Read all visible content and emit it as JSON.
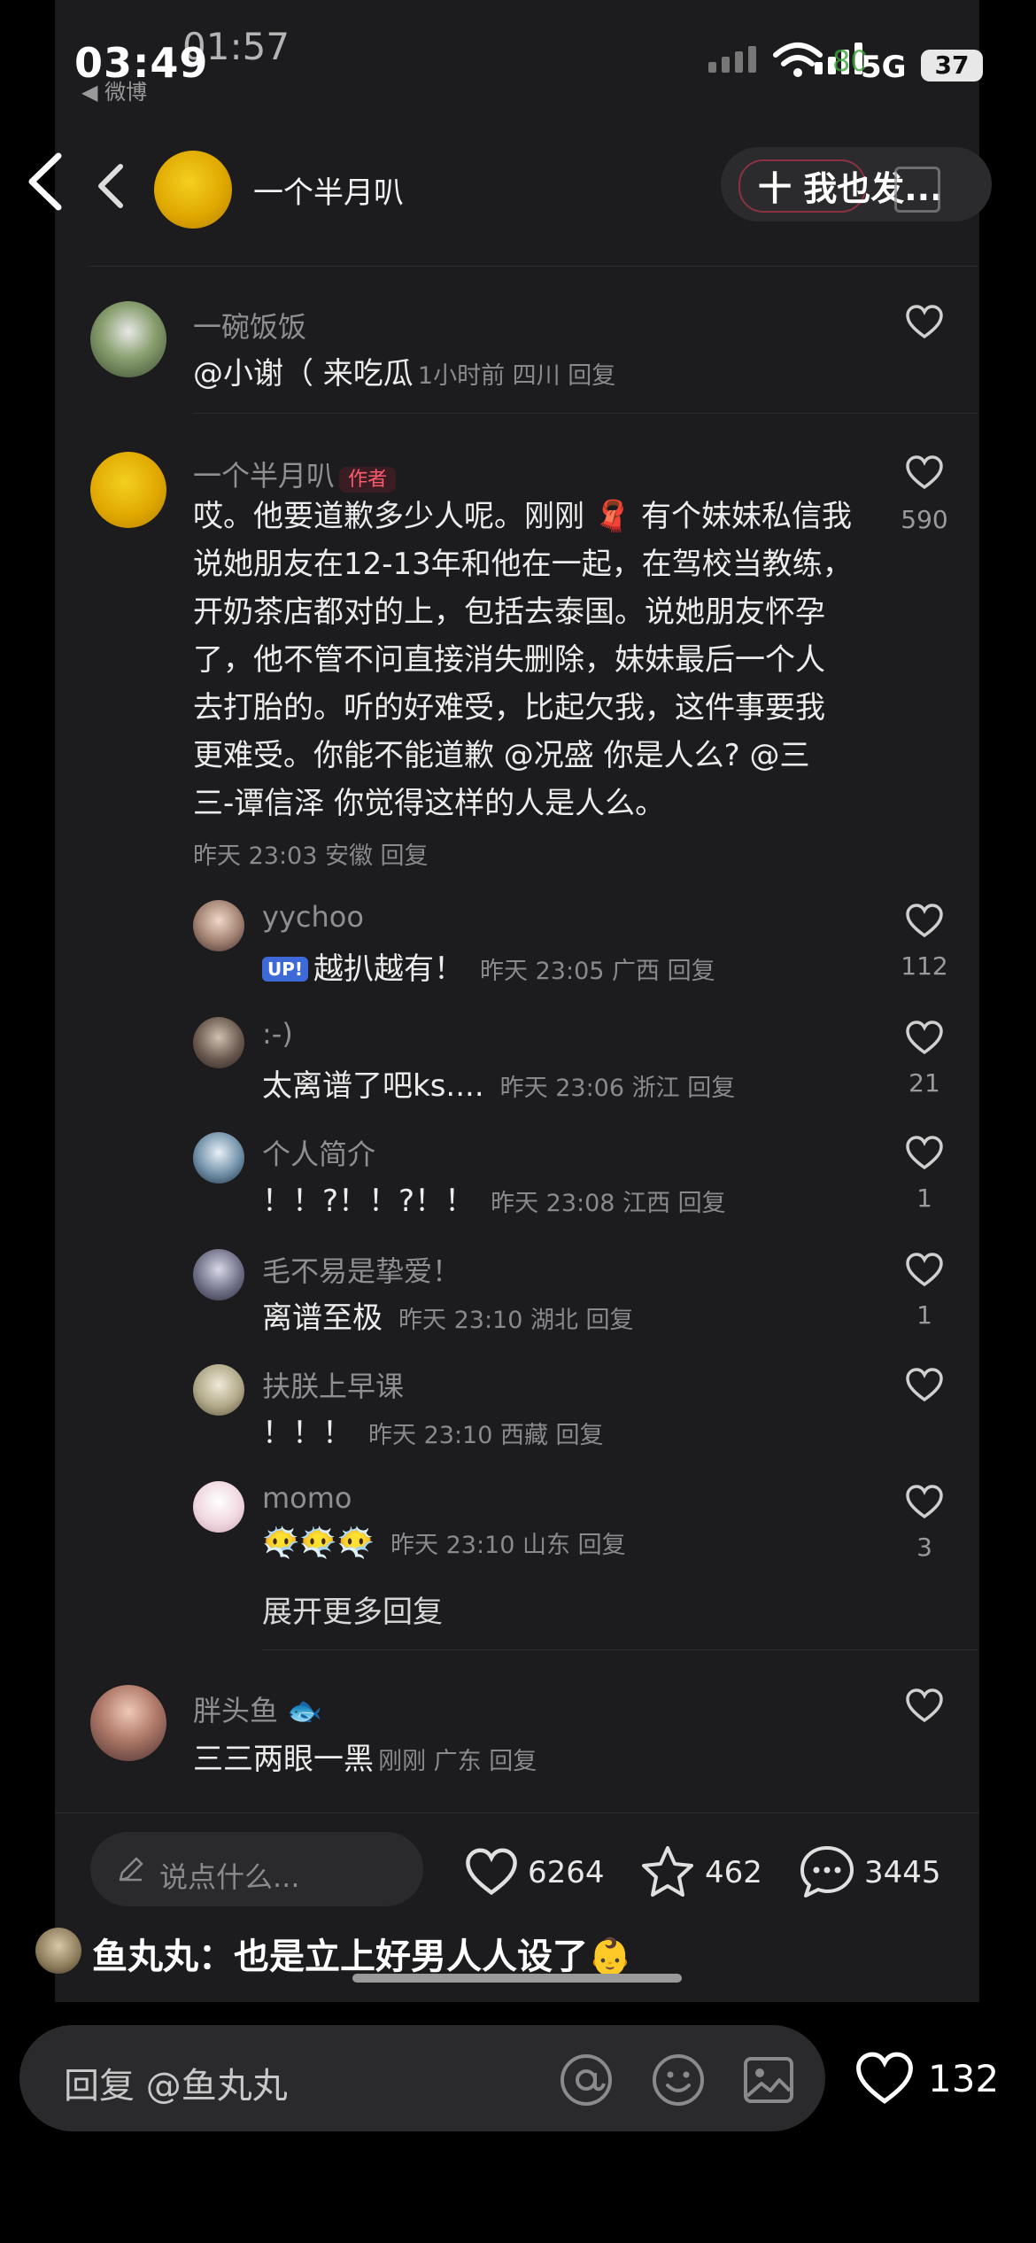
{
  "status_bar": {
    "time": "03:49",
    "ghost_time": "01:57",
    "back_app": "◀ 微博",
    "network": "5G",
    "battery": "37",
    "ghost_battery": "80"
  },
  "header": {
    "username": "一个半月叭",
    "follow_label": "十 我也发..."
  },
  "comments": [
    {
      "username": "一碗饭饭",
      "text": "@小谢（ 来吃瓜",
      "meta": "1小时前 四川 回复"
    },
    {
      "username": "一个半月叭",
      "author_tag": "作者",
      "likes": "590",
      "lines": [
        "哎。他要道歉多少人呢。刚刚 🧣 有个妹妹私信我",
        "说她朋友在12-13年和他在一起，在驾校当教练，",
        "开奶茶店都对的上，包括去泰国。说她朋友怀孕",
        "了，他不管不问直接消失删除，妹妹最后一个人",
        "去打胎的。听的好难受，比起欠我，这件事要我",
        "更难受。你能不能道歉 @况盛 你是人么? @三",
        "三-谭信泽 你觉得这样的人是人么。"
      ],
      "meta": "昨天 23:03 安徽 回复"
    }
  ],
  "replies": [
    {
      "username": "yychoo",
      "badge": "UP!",
      "text": "越扒越有！",
      "meta": "昨天 23:05 广西 回复",
      "likes": "112"
    },
    {
      "username": ":-)",
      "text": "太离谱了吧ks....",
      "meta": "昨天 23:06 浙江 回复",
      "likes": "21"
    },
    {
      "username": "个人简介",
      "text": "！！?！！?！！",
      "meta": "昨天 23:08 江西 回复",
      "likes": "1"
    },
    {
      "username": "毛不易是挚爱！",
      "text": "离谱至极",
      "meta": "昨天 23:10 湖北 回复",
      "likes": "1"
    },
    {
      "username": "扶朕上早课",
      "text": "！！！",
      "meta": "昨天 23:10 西藏 回复",
      "likes": ""
    },
    {
      "username": "momo",
      "text": "😶‍🌫️😶‍🌫️😶‍🌫️",
      "meta": "昨天 23:10 山东 回复",
      "likes": "3"
    }
  ],
  "expand_more": "展开更多回复",
  "last_comment": {
    "username": "胖头鱼 🐟",
    "text": "三三两眼一黑",
    "meta": "刚刚 广东 回复"
  },
  "bottom_bar": {
    "placeholder": "说点什么...",
    "likes": "6264",
    "stars": "462",
    "comments": "3445"
  },
  "overlay": {
    "text": "鱼丸丸：也是立上好男人人设了👶"
  },
  "reply_bar": {
    "placeholder": "回复 @鱼丸丸",
    "likes": "132"
  },
  "colors": {
    "background": "#000000",
    "panel": "#1c1c1e",
    "author_tag": "#ff5a6e",
    "follow_ring": "#b5364a"
  }
}
